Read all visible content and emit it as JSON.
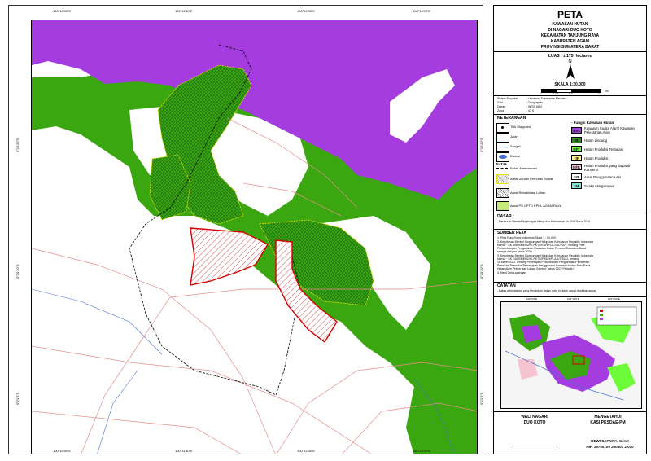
{
  "title": {
    "main": "PETA",
    "lines": [
      "KAWASAN HUTAN",
      "DI NAGARI DUO KOTO",
      "KECAMATAN TANJUNG RAYA",
      "KABUPATEN AGAM",
      "PROVINSI SUMATERA BARAT"
    ]
  },
  "area": "LUAS : ± 175 Hectares",
  "north_label": "N",
  "scale_text": "SKALA   1:30.000",
  "scale_ticks": [
    "0",
    "0.25",
    "0.5",
    "1"
  ],
  "scale_unit": "Km",
  "projection": {
    "labels": [
      "Sistem Proyeksi",
      "Grid",
      "Datum",
      "Zona"
    ],
    "values": [
      ": Universal Transverse Mercator",
      ": Geographic",
      ": WGS 1984",
      ": 47 S"
    ]
  },
  "legend": {
    "heading": "KETERANGAN",
    "left": [
      {
        "icon": "waypoint-icon",
        "label": "Titik Waypoint"
      },
      {
        "icon": "road-icon",
        "label": "Jalan"
      },
      {
        "icon": "river-icon",
        "label": "Sungai"
      },
      {
        "icon": "lake-icon",
        "label": "Danau"
      },
      {
        "icon": "admin-boundary-icon",
        "label": "Batas Administrasi"
      },
      {
        "icon": "social-forestry-icon",
        "label": "Areal Usulan Perhutan Sosial"
      },
      {
        "icon": "rehab-icon",
        "label": "Areal Rehabilitasi Lahan"
      },
      {
        "icon": "kphl-icon",
        "label": "Areal PS UPTD KPHL AGAM RAYA"
      }
    ],
    "right_heading": "- Fungsi Kawasan Hutan",
    "right": [
      {
        "code": "KSA",
        "label": "Kawasan Suaka Alam/ Kawasan Pelestarian Alam",
        "color": "#a43ce0"
      },
      {
        "code": "HL",
        "label": "Hutan Lindung",
        "color": "#2e8b1a"
      },
      {
        "code": "HPT",
        "label": "Hutan Produksi Terbatas",
        "color": "#6dfb3a"
      },
      {
        "code": "HP",
        "label": "Hutan Produksi",
        "color": "#fef87e"
      },
      {
        "code": "HPK",
        "label": "Hutan Produksi yang dapat di Konversi",
        "color": "#f6c3d0"
      },
      {
        "code": "APL",
        "label": "Areal Penggunaan Lain",
        "color": "#ffffff"
      },
      {
        "code": "SM",
        "label": "Suaka Margasatwa",
        "color": "#7fe7d8"
      }
    ],
    "boundary_label": "BATAS"
  },
  "dasar": {
    "heading": "DASAR :",
    "text": "- Peraturan Menteri lingkungan Hidup dan Kehutanan No. P.9 Tahun 2016"
  },
  "sumber": {
    "heading": "SUMBER PETA",
    "lines": [
      "1. Peta Rupa Bumi Indonesia Skala 1 : 50.000.",
      "2. Keputusan Menteri Lingkungan Hidup dan Kehutanan Republik Indonesia",
      "    Nomor : SK. 6599/MENLHK-PKTL/KUH/PLA.2/11/2021, tentang Peta",
      "    Perkembangan Pengukuhan Kawasan Hutan Provinsi Sumatera Barat",
      "    sampai dengan tahun 2020.",
      "3. Keputusan Menteri Lingkungan Hidup dan Kehutanan Republik Indonesia",
      "    Nomor : SK. 1629/MENLHK-PKTL/IPSDH/PLA.1/3/2022, tentang",
      "    11 Maret 2022 Tentang Penetapan Peta Indikatif Penghentian Pemberian",
      "    Perizinan Berusaha Persetujuan Penggunaan Kawasan Hutan Baru Pada",
      "    Hutan Alam Primer dan Lahan Gambut Tahun 2022 Periode I",
      "4. Hasil Cek Lapangan."
    ]
  },
  "catatan": {
    "heading": "CATATAN",
    "text": "- Batas administrasi yang tercantum dalam peta ini tidak dapat dijadikan acuan"
  },
  "inset_ticks": [
    "100°0'0\"E",
    "100°10'0\"E",
    "100°20'0\"E"
  ],
  "signatures": {
    "left_title": [
      "WALI NAGARI",
      "DUO KOTO"
    ],
    "right_title": [
      "MENGETAHUI",
      "KASI PKSDAE-PM"
    ],
    "right_name": "DEWI SAFNITA, S.Hut",
    "right_nip": "NIP. 19750109 200501 2 010"
  },
  "map_ticks": {
    "top": [
      "100°10'50\"E",
      "100°11'40\"E",
      "100°12'30\"E",
      "100°13'20\"E"
    ],
    "bottom": [
      "100°10'50\"E",
      "100°11'40\"E",
      "100°12'30\"E",
      "100°13'20\"E"
    ],
    "left": [
      "0°19'20\"S",
      "0°20'10\"S",
      "0°21'0\"S"
    ],
    "right": [
      "0°19'20\"S",
      "0°20'10\"S",
      "0°21'0\"S"
    ]
  },
  "colors": {
    "ksa": "#a43ce0",
    "hl": "#3aa711",
    "hutan_lindung_hatch": "#1f6b12",
    "rehab": "#d40000",
    "road": "#e58f8f",
    "river": "#4a6fd1",
    "boundary": "#000000"
  }
}
